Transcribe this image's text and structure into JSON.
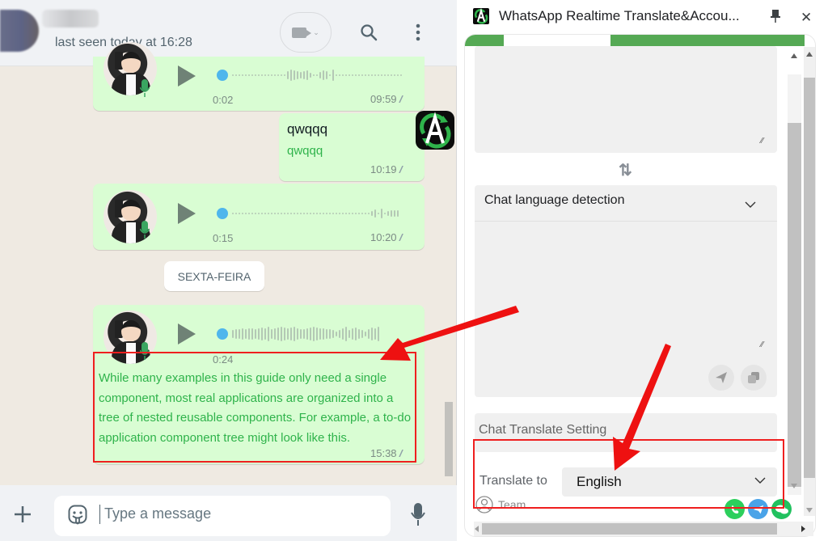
{
  "chat": {
    "header": {
      "last_seen": "last seen today at 16:28",
      "icons": [
        "video-call-icon",
        "chevron-down-icon",
        "search-icon",
        "menu-icon"
      ]
    },
    "messages": [
      {
        "type": "voice",
        "duration": "0:02",
        "time": "09:59",
        "status": "read"
      },
      {
        "type": "text",
        "text": "qwqqq",
        "translation": "qwqqq",
        "time": "10:19",
        "status": "read"
      },
      {
        "type": "voice",
        "duration": "0:15",
        "time": "10:20",
        "status": "read"
      },
      {
        "type": "voice",
        "duration": "0:24",
        "time": "15:38",
        "status": "read",
        "translation": "While many examples in this guide only need a single component, most real applications are organized into a tree of nested reusable components. For example, a to-do application component tree might look like this."
      }
    ],
    "date_chip": "SEXTA-FEIRA",
    "composer": {
      "placeholder": "Type a message"
    }
  },
  "panel": {
    "title": "WhatsApp Realtime Translate&Accou...",
    "detection_label": "Chat language detection",
    "setting_title": "Chat Translate Setting",
    "translate_to_label": "Translate to",
    "translate_to_value": "English",
    "team_label": "Team",
    "social_icons": [
      "whatsapp-icon",
      "telegram-icon",
      "wechat-icon"
    ]
  },
  "colors": {
    "bubble": "#d9fdd3",
    "translation_text": "#2fb34b",
    "panel_accent": "#55a954",
    "annotation": "#ef1f1f"
  }
}
